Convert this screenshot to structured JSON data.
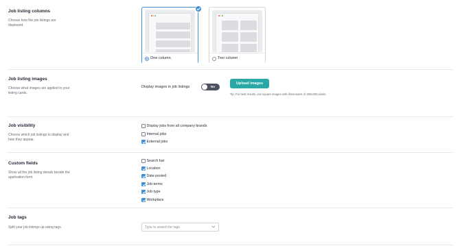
{
  "sections": {
    "columns": {
      "title": "Job listing columns",
      "description": "Choose how the job listings are displayed.",
      "options": [
        {
          "label": "One column",
          "selected": true
        },
        {
          "label": "Two column",
          "selected": false
        }
      ]
    },
    "images": {
      "title": "Job listing images",
      "description": "Choose what images are applied to your listing cards.",
      "toggle_label": "Display images in job listings",
      "toggle_state": "No",
      "upload_label": "Upload images",
      "tip": "Tip: For best results, use square images with dimensions of 300x300 pixels."
    },
    "visibility": {
      "title": "Job visibility",
      "description": "Choose which job listings to display and how they appear.",
      "options": [
        {
          "label": "Display jobs from all company brands",
          "checked": false
        },
        {
          "label": "Internal jobs",
          "checked": false
        },
        {
          "label": "External jobs",
          "checked": true
        }
      ]
    },
    "custom_fields": {
      "title": "Custom fields",
      "description": "Show all the job listing details beside the application form.",
      "options": [
        {
          "label": "Search bar",
          "checked": false
        },
        {
          "label": "Location",
          "checked": true
        },
        {
          "label": "Date posted",
          "checked": true
        },
        {
          "label": "Job terms",
          "checked": true
        },
        {
          "label": "Job type",
          "checked": true
        },
        {
          "label": "Workplace",
          "checked": true
        }
      ]
    },
    "tags": {
      "title": "Job tags",
      "description": "Split your job listings up using tags.",
      "placeholder": "Type to search for tags"
    }
  },
  "colors": {
    "accent": "#3e8fd8",
    "teal_button": "#2aa8a8",
    "toggle_off": "#4b5260",
    "dot_red": "#e06a5a",
    "dot_yellow": "#e8b84a",
    "dot_green": "#6cc070"
  },
  "icons": [
    "check-icon",
    "chevron-down-icon"
  ]
}
